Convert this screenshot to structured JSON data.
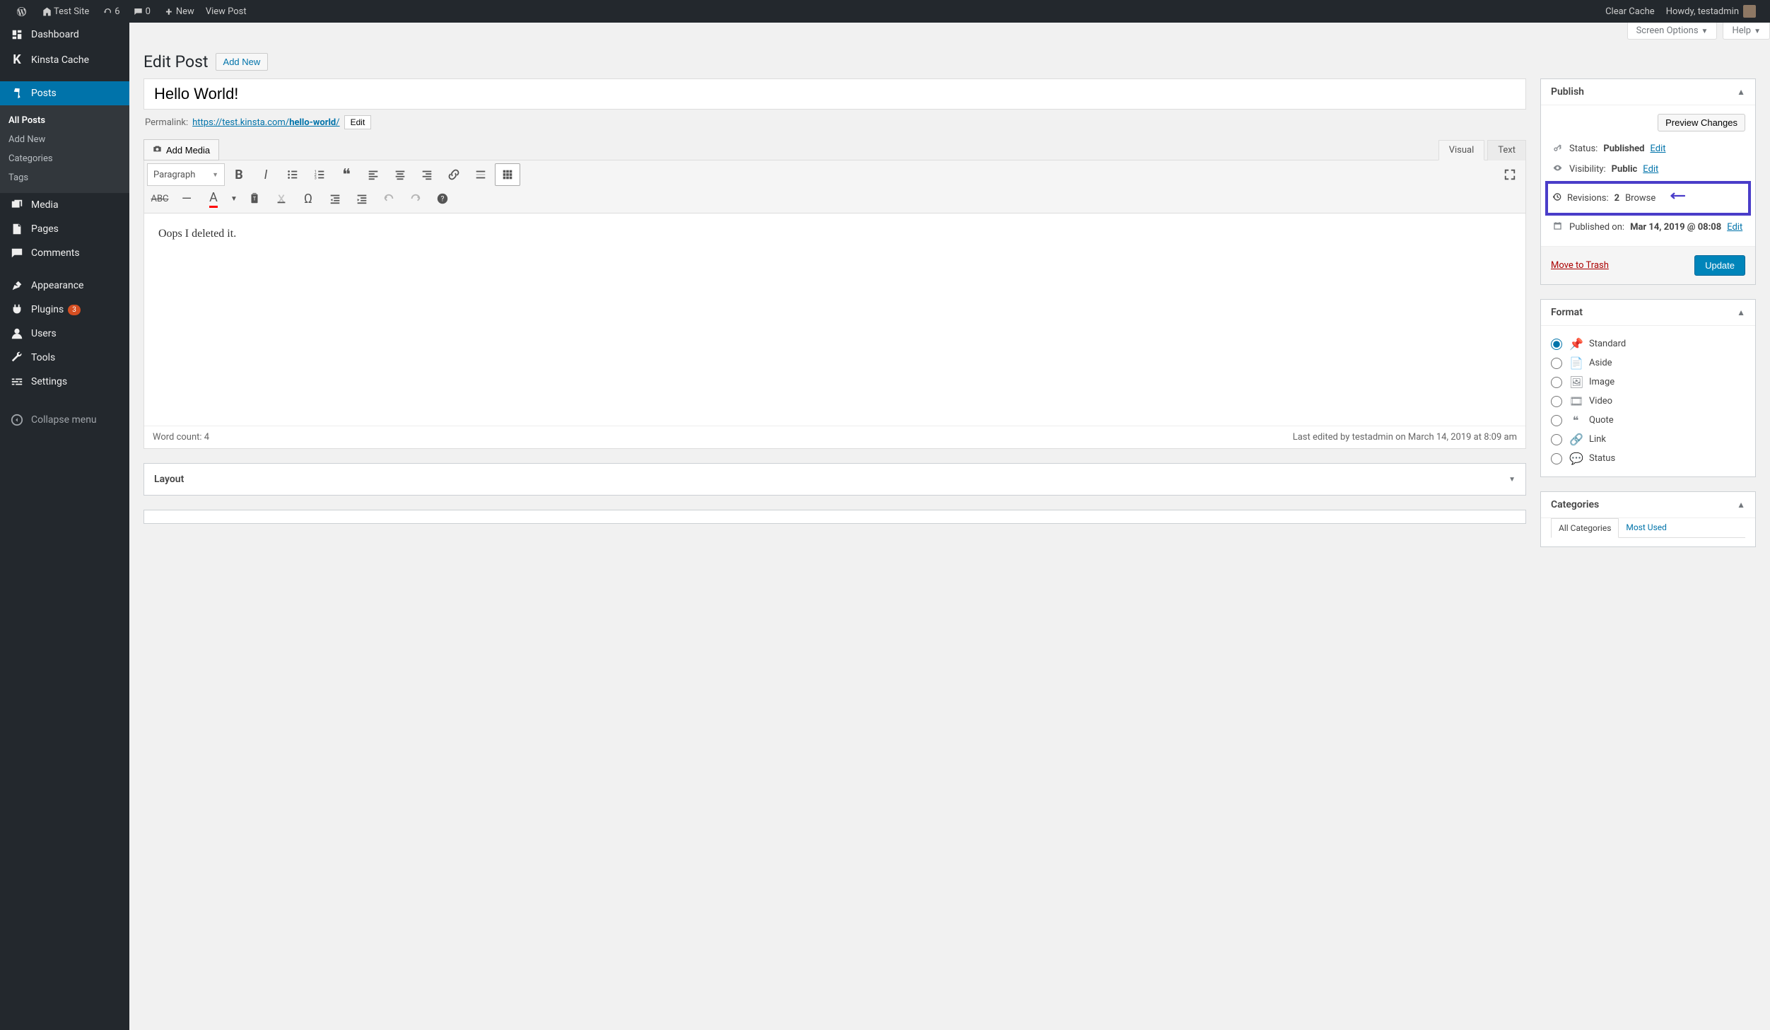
{
  "adminbar": {
    "site_name": "Test Site",
    "updates": "6",
    "comments": "0",
    "new": "New",
    "view_post": "View Post",
    "clear_cache": "Clear Cache",
    "howdy": "Howdy, testadmin"
  },
  "sidebar": {
    "dashboard": "Dashboard",
    "kinsta": "Kinsta Cache",
    "posts": "Posts",
    "posts_sub": {
      "all": "All Posts",
      "add": "Add New",
      "cats": "Categories",
      "tags": "Tags"
    },
    "media": "Media",
    "pages": "Pages",
    "comments": "Comments",
    "appearance": "Appearance",
    "plugins": "Plugins",
    "plugins_count": "3",
    "users": "Users",
    "tools": "Tools",
    "settings": "Settings",
    "collapse": "Collapse menu"
  },
  "meta": {
    "screen_options": "Screen Options",
    "help": "Help"
  },
  "heading": {
    "title": "Edit Post",
    "add_new": "Add New"
  },
  "post": {
    "title": "Hello World!",
    "permalink_label": "Permalink:",
    "permalink_base": "https://test.kinsta.com/",
    "permalink_slug": "hello-world",
    "edit_btn": "Edit",
    "add_media": "Add Media",
    "visual_tab": "Visual",
    "text_tab": "Text",
    "format_selector": "Paragraph",
    "body": "Oops I deleted it.",
    "word_count_label": "Word count: 4",
    "last_edited": "Last edited by testadmin on March 14, 2019 at 8:09 am"
  },
  "publish": {
    "title": "Publish",
    "preview": "Preview Changes",
    "status_label": "Status:",
    "status_val": "Published",
    "visibility_label": "Visibility:",
    "visibility_val": "Public",
    "revisions_label": "Revisions:",
    "revisions_count": "2",
    "browse": "Browse",
    "published_label": "Published on:",
    "published_val": "Mar 14, 2019 @ 08:08",
    "edit": "Edit",
    "trash": "Move to Trash",
    "update": "Update"
  },
  "format": {
    "title": "Format",
    "standard": "Standard",
    "aside": "Aside",
    "image": "Image",
    "video": "Video",
    "quote": "Quote",
    "link": "Link",
    "status": "Status"
  },
  "categories": {
    "title": "Categories",
    "all_tab": "All Categories",
    "most_used_tab": "Most Used"
  },
  "layout": {
    "title": "Layout"
  }
}
